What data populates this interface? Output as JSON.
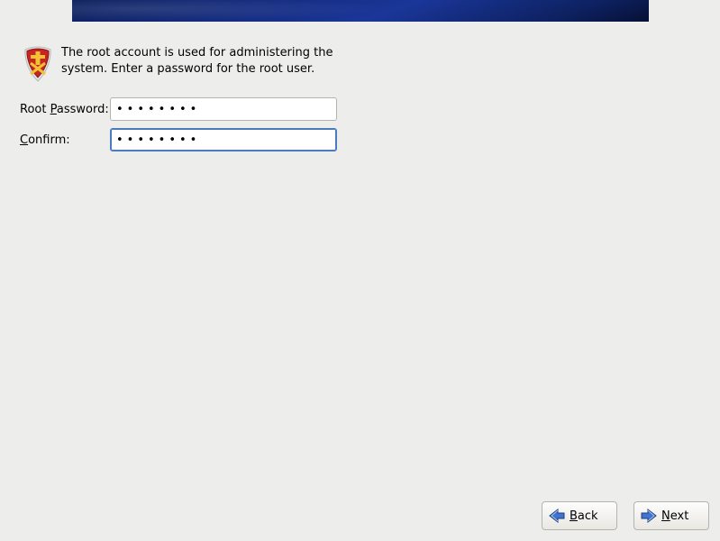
{
  "description": "The root account is used for administering the system.  Enter a password for the root user.",
  "labels": {
    "root_password_pre": "Root ",
    "root_password_u": "P",
    "root_password_post": "assword:",
    "confirm_u": "C",
    "confirm_post": "onfirm:"
  },
  "fields": {
    "root_password": "••••••••",
    "confirm": "••••••••"
  },
  "buttons": {
    "back_u": "B",
    "back_post": "ack",
    "next_u": "N",
    "next_post": "ext"
  },
  "icons": {
    "shield": "shield-icon",
    "arrow_left": "arrow-left-icon",
    "arrow_right": "arrow-right-icon"
  }
}
